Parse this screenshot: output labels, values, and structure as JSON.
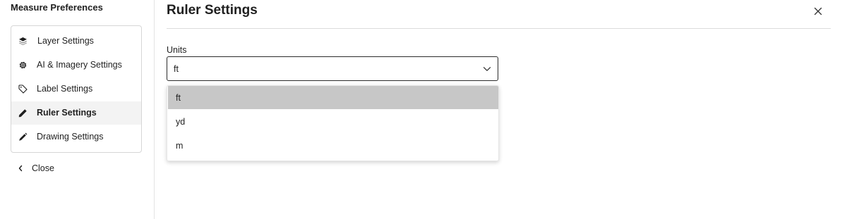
{
  "sidebar": {
    "title": "Measure Preferences",
    "items": [
      {
        "label": "Layer Settings",
        "icon": "layers-icon",
        "active": false
      },
      {
        "label": "AI & Imagery Settings",
        "icon": "gear-icon",
        "active": false
      },
      {
        "label": "Label Settings",
        "icon": "tag-icon",
        "active": false
      },
      {
        "label": "Ruler Settings",
        "icon": "ruler-icon",
        "active": true
      },
      {
        "label": "Drawing Settings",
        "icon": "pencil-icon",
        "active": false
      }
    ],
    "close_label": "Close"
  },
  "main": {
    "title": "Ruler Settings",
    "units": {
      "label": "Units",
      "selected": "ft",
      "options": [
        "ft",
        "yd",
        "m"
      ]
    }
  },
  "colors": {
    "active_item_bg": "#f3f3f3",
    "selected_option_bg": "#c7c7c7",
    "text": "#1f1f1f",
    "border": "#d6d6d6"
  }
}
